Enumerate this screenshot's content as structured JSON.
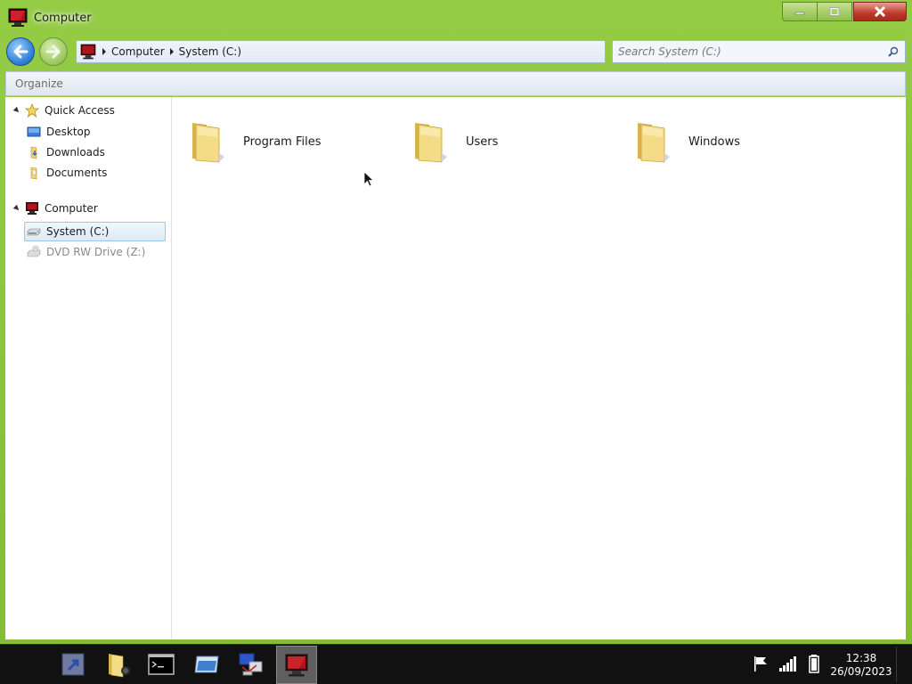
{
  "window": {
    "title": "Computer"
  },
  "navigation": {
    "breadcrumb": [
      "Computer",
      "System (C:)"
    ],
    "search_placeholder": "Search System (C:)"
  },
  "toolbar": {
    "organize_label": "Organize"
  },
  "sidebar": {
    "quick_access": {
      "label": "Quick Access",
      "items": [
        "Desktop",
        "Downloads",
        "Documents"
      ]
    },
    "computer": {
      "label": "Computer",
      "items": [
        {
          "label": "System (C:)",
          "selected": true
        },
        {
          "label": "DVD RW Drive (Z:)",
          "selected": false
        }
      ]
    }
  },
  "folders": [
    "Program Files",
    "Users",
    "Windows"
  ],
  "taskbar": {
    "apps": [
      "pointer-app-icon",
      "file-manager-icon",
      "terminal-icon",
      "window-manager-icon",
      "network-icon",
      "computer-icon"
    ],
    "active_app": "computer-icon",
    "time": "12:38",
    "date": "26/09/2023"
  },
  "colors": {
    "window_frame": "#8ec63f",
    "close_button": "#c0392b",
    "selection": "#dceaf9"
  }
}
